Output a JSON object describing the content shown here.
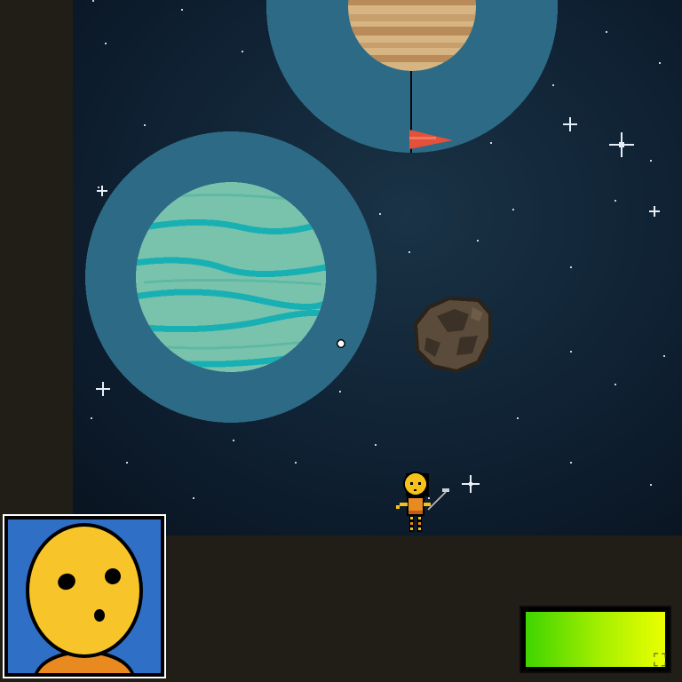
{
  "game": {
    "colors": {
      "space": "#0e1c2e",
      "hud_bg": "#211d17",
      "orbit_ring": "#2d6a85",
      "ice_planet": "#79c3ad",
      "ice_band": "#19b0b3",
      "gas_planet": "#d6b583",
      "gas_band": "#b88b58",
      "flag": "#e5503b",
      "asteroid": "#5a4b3a",
      "astronaut": "#f6c21a",
      "portrait_bg": "#2f6fc6"
    },
    "icons": {
      "flag": "hole-flag-icon",
      "ball": "golf-ball-icon",
      "player": "astronaut-golfer-icon",
      "fullscreen": "fullscreen-icon"
    },
    "hud": {
      "energy_level": 1.0,
      "fullscreen_glyph": "⛶"
    }
  }
}
